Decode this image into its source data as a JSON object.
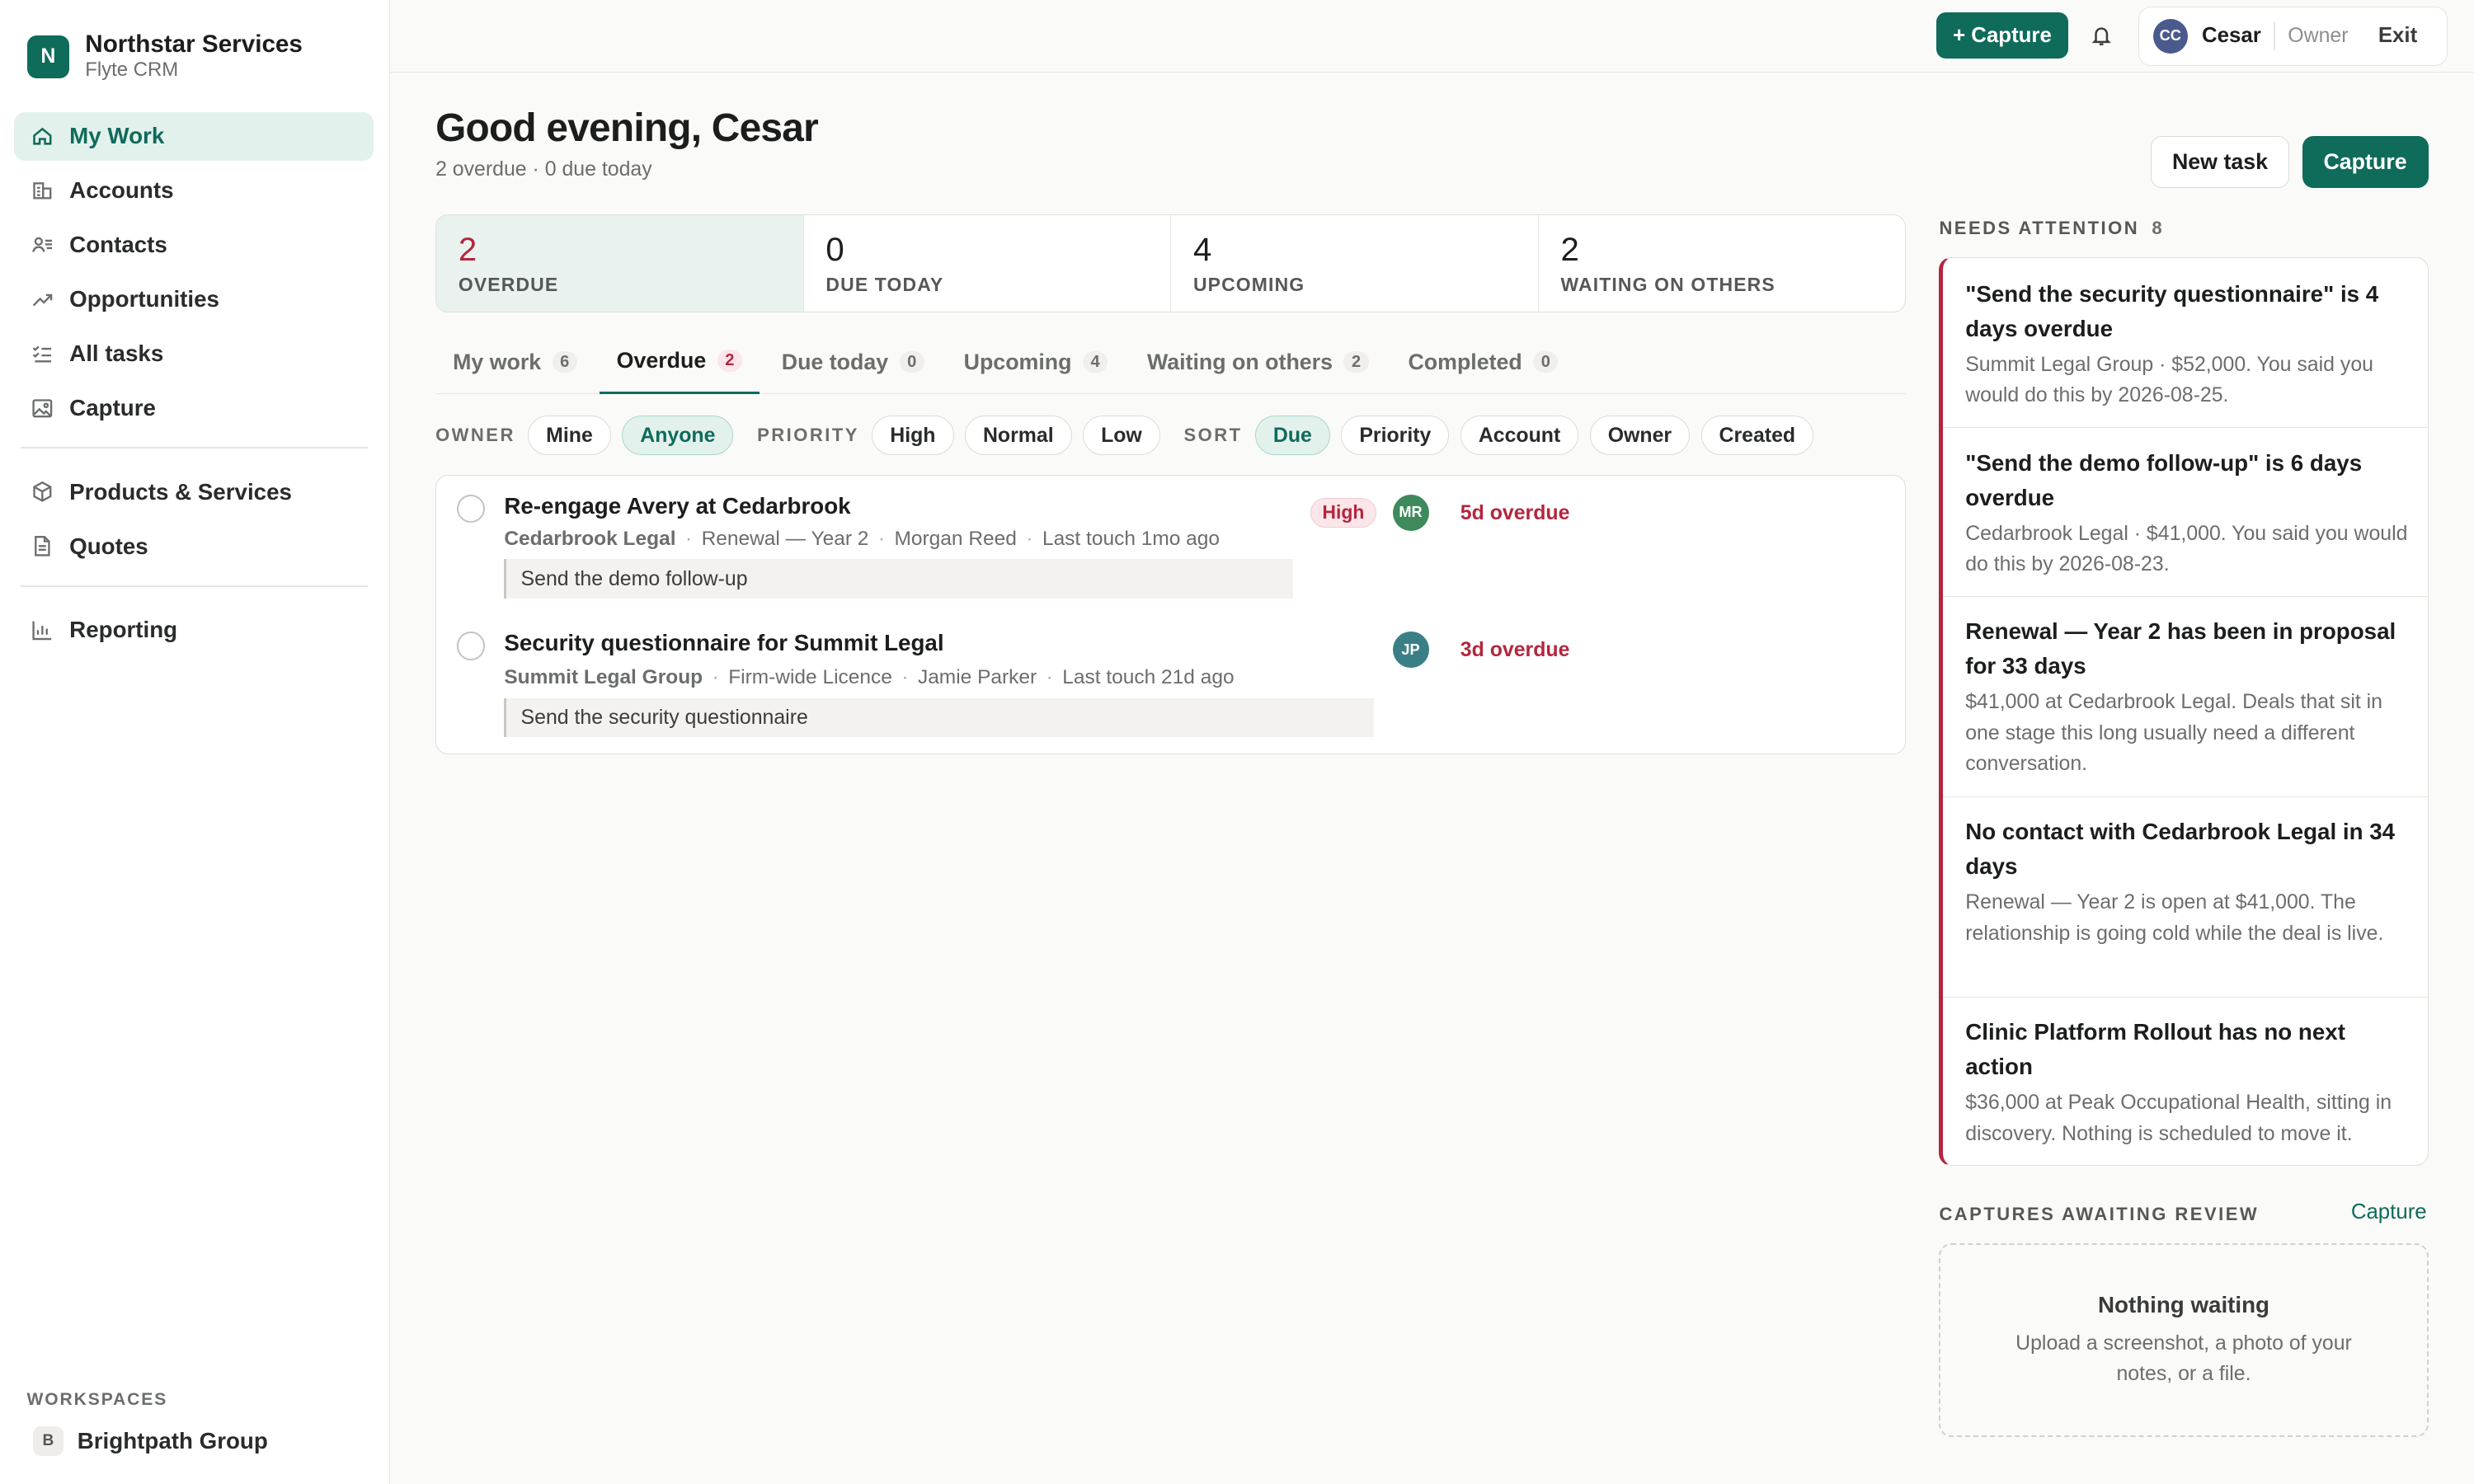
{
  "brand": {
    "initial": "N",
    "name": "Northstar Services",
    "sub": "Flyte CRM"
  },
  "nav": {
    "items": [
      {
        "label": "My Work",
        "icon": "home-icon",
        "active": true
      },
      {
        "label": "Accounts",
        "icon": "building-icon"
      },
      {
        "label": "Contacts",
        "icon": "contacts-icon"
      },
      {
        "label": "Opportunities",
        "icon": "trend-icon"
      },
      {
        "label": "All tasks",
        "icon": "checklist-icon"
      },
      {
        "label": "Capture",
        "icon": "image-icon"
      },
      {
        "label": "Products & Services",
        "icon": "box-icon"
      },
      {
        "label": "Quotes",
        "icon": "document-icon"
      },
      {
        "label": "Reporting",
        "icon": "bar-chart-icon"
      }
    ]
  },
  "workspaces": {
    "label": "WORKSPACES",
    "items": [
      {
        "initial": "B",
        "name": "Brightpath Group"
      }
    ]
  },
  "topbar": {
    "capture_label": "+ Capture",
    "user": {
      "initials": "CC",
      "name": "Cesar",
      "role": "Owner",
      "exit": "Exit"
    }
  },
  "header": {
    "greeting": "Good evening, Cesar",
    "summary": "2 overdue · 0 due today",
    "new_task": "New task",
    "capture": "Capture"
  },
  "stats": [
    {
      "value": "2",
      "label": "OVERDUE"
    },
    {
      "value": "0",
      "label": "DUE TODAY"
    },
    {
      "value": "4",
      "label": "UPCOMING"
    },
    {
      "value": "2",
      "label": "WAITING ON OTHERS"
    }
  ],
  "tabs": [
    {
      "label": "My work",
      "count": "6"
    },
    {
      "label": "Overdue",
      "count": "2"
    },
    {
      "label": "Due today",
      "count": "0"
    },
    {
      "label": "Upcoming",
      "count": "4"
    },
    {
      "label": "Waiting on others",
      "count": "2"
    },
    {
      "label": "Completed",
      "count": "0"
    }
  ],
  "filters": {
    "owner_label": "OWNER",
    "owner": [
      "Mine",
      "Anyone"
    ],
    "priority_label": "PRIORITY",
    "priority": [
      "High",
      "Normal",
      "Low"
    ],
    "sort_label": "SORT",
    "sort": [
      "Due",
      "Priority",
      "Account",
      "Owner",
      "Created"
    ]
  },
  "tasks": [
    {
      "title": "Re-engage Avery at Cedarbrook",
      "account": "Cedarbrook Legal",
      "deal": "Renewal — Year 2",
      "owner": "Morgan Reed",
      "touch": "Last touch 1mo ago",
      "note": "Send the demo follow-up",
      "priority": "High",
      "avatar": "MR",
      "due": "5d overdue"
    },
    {
      "title": "Security questionnaire for Summit Legal",
      "account": "Summit Legal Group",
      "deal": "Firm-wide Licence",
      "owner": "Jamie Parker",
      "touch": "Last touch 21d ago",
      "note": "Send the security questionnaire",
      "avatar": "JP",
      "due": "3d overdue"
    }
  ],
  "attention": {
    "label": "NEEDS ATTENTION",
    "count": "8",
    "items": [
      {
        "title": "\"Send the security questionnaire\" is 4 days overdue",
        "body": "Summit Legal Group · $52,000. You said you would do this by 2026-08-25."
      },
      {
        "title": "\"Send the demo follow-up\" is 6 days overdue",
        "body": "Cedarbrook Legal · $41,000. You said you would do this by 2026-08-23."
      },
      {
        "title": "Renewal — Year 2 has been in proposal for 33 days",
        "body": "$41,000 at Cedarbrook Legal. Deals that sit in one stage this long usually need a different conversation."
      },
      {
        "title": "No contact with Cedarbrook Legal in 34 days",
        "body": "Renewal — Year 2 is open at $41,000. The relationship is going cold while the deal is live."
      },
      {
        "title": "Clinic Platform Rollout has no next action",
        "body": "$36,000 at Peak Occupational Health, sitting in discovery. Nothing is scheduled to move it."
      }
    ]
  },
  "captures": {
    "label": "CAPTURES AWAITING REVIEW",
    "link": "Capture",
    "empty_title": "Nothing waiting",
    "empty_body": "Upload a screenshot, a photo of your notes, or a file."
  },
  "colors": {
    "accent": "#0f6b5a",
    "danger": "#b3263e",
    "avatar_mr": "#3f8a5c",
    "avatar_jp": "#3a7f86",
    "avatar_cc": "#4b5a8c"
  }
}
